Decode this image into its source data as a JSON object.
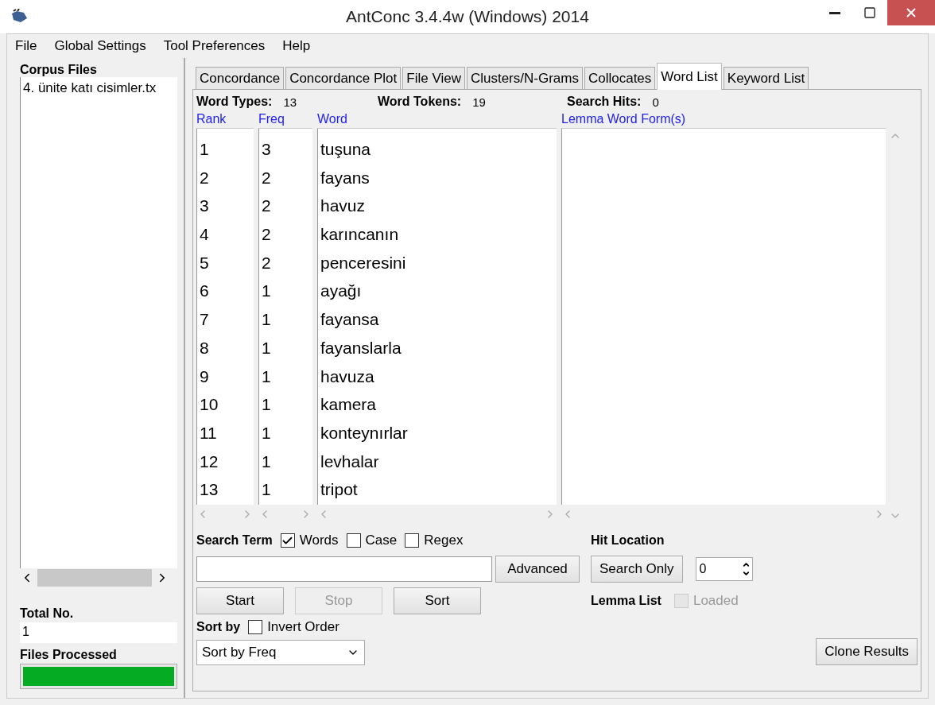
{
  "window": {
    "title": "AntConc 3.4.4w (Windows) 2014"
  },
  "menu": [
    "File",
    "Global Settings",
    "Tool Preferences",
    "Help"
  ],
  "corpus": {
    "label": "Corpus Files",
    "files": [
      "4. ünite katı cisimler.tx"
    ],
    "total_label": "Total No.",
    "total": "1",
    "processed_label": "Files Processed",
    "progress": {
      "level": 1
    }
  },
  "tabs": [
    {
      "label": "Concordance",
      "selected": false
    },
    {
      "label": "Concordance Plot",
      "selected": false
    },
    {
      "label": "File View",
      "selected": false
    },
    {
      "label": "Clusters/N-Grams",
      "selected": false
    },
    {
      "label": "Collocates",
      "selected": false
    },
    {
      "label": "Word List",
      "selected": true
    },
    {
      "label": "Keyword List",
      "selected": false
    }
  ],
  "stats": [
    {
      "label": "Word Types:",
      "value": "13"
    },
    {
      "label": "Word Tokens:",
      "value": "19"
    },
    {
      "label": "Search Hits:",
      "value": "0"
    }
  ],
  "columns": [
    "Rank",
    "Freq",
    "Word",
    "Lemma Word Form(s)"
  ],
  "rows": [
    {
      "rank": "1",
      "freq": "3",
      "word": "tuşuna"
    },
    {
      "rank": "2",
      "freq": "2",
      "word": "fayans"
    },
    {
      "rank": "3",
      "freq": "2",
      "word": "havuz"
    },
    {
      "rank": "4",
      "freq": "2",
      "word": "karıncanın"
    },
    {
      "rank": "5",
      "freq": "2",
      "word": "penceresini"
    },
    {
      "rank": "6",
      "freq": "1",
      "word": "ayağı"
    },
    {
      "rank": "7",
      "freq": "1",
      "word": "fayansa"
    },
    {
      "rank": "8",
      "freq": "1",
      "word": "fayanslarla"
    },
    {
      "rank": "9",
      "freq": "1",
      "word": "havuza"
    },
    {
      "rank": "10",
      "freq": "1",
      "word": "kamera"
    },
    {
      "rank": "11",
      "freq": "1",
      "word": "konteynırlar"
    },
    {
      "rank": "12",
      "freq": "1",
      "word": "levhalar"
    },
    {
      "rank": "13",
      "freq": "1",
      "word": "tripot"
    }
  ],
  "search": {
    "label": "Search Term",
    "options": [
      {
        "label": "Words",
        "checked": true
      },
      {
        "label": "Case",
        "checked": false
      },
      {
        "label": "Regex",
        "checked": false
      }
    ],
    "advanced": "Advanced"
  },
  "actions": [
    {
      "label": "Start",
      "disabled": false
    },
    {
      "label": "Stop",
      "disabled": true
    },
    {
      "label": "Sort",
      "disabled": false
    }
  ],
  "sort": {
    "label": "Sort by",
    "invert": {
      "label": "Invert Order",
      "checked": false
    },
    "value": "Sort by Freq"
  },
  "hit_location": {
    "label": "Hit Location",
    "button": "Search Only",
    "value": "0"
  },
  "lemma_list": {
    "label": "Lemma List",
    "checkbox": {
      "label": "Loaded",
      "checked": false,
      "disabled": true
    }
  },
  "clone": "Clone Results"
}
